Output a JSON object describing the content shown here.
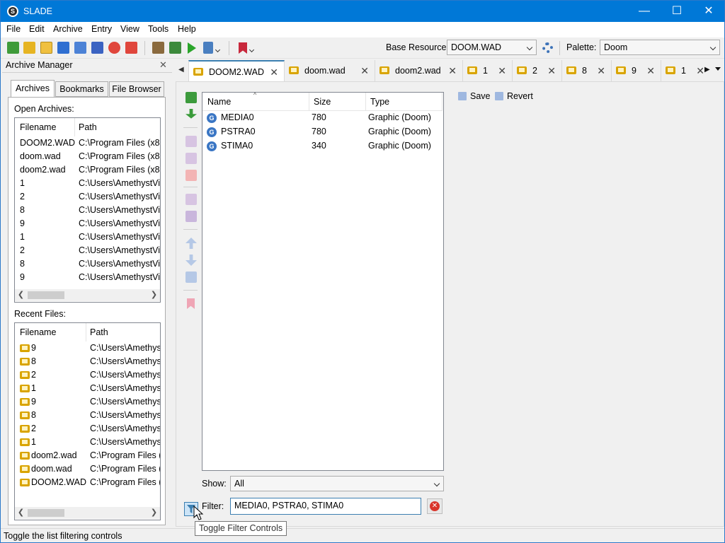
{
  "app": {
    "title": "SLADE",
    "icon_letter": "S"
  },
  "window_buttons": {
    "minimize": "—",
    "maximize": "☐",
    "close": "✕"
  },
  "menu": [
    "File",
    "Edit",
    "Archive",
    "Entry",
    "View",
    "Tools",
    "Help"
  ],
  "toolbar": {
    "base_resource_label": "Base Resource:",
    "base_resource_value": "DOOM.WAD",
    "palette_label": "Palette:",
    "palette_value": "Doom",
    "icons": [
      "new-archive-icon",
      "new-zip-icon",
      "open-icon",
      "open-dir-icon",
      "save-icon",
      "save-as-icon",
      "save-all-icon",
      "close-icon",
      "close-all-icon",
      "texture-editor-icon",
      "map-editor-icon",
      "run-icon",
      "tools-icon",
      "bookmark-icon"
    ]
  },
  "archive_manager": {
    "title": "Archive Manager",
    "close": "✕",
    "tabs": [
      "Archives",
      "Bookmarks",
      "File Browser"
    ],
    "open_archives_label": "Open Archives:",
    "open_headers": [
      "Filename",
      "Path"
    ],
    "open_rows": [
      [
        "DOOM2.WAD",
        "C:\\Program Files (x86"
      ],
      [
        "doom.wad",
        "C:\\Program Files (x86"
      ],
      [
        "doom2.wad",
        "C:\\Program Files (x86"
      ],
      [
        "1",
        "C:\\Users\\AmethystVip"
      ],
      [
        "2",
        "C:\\Users\\AmethystVip"
      ],
      [
        "8",
        "C:\\Users\\AmethystVip"
      ],
      [
        "9",
        "C:\\Users\\AmethystVip"
      ],
      [
        "1",
        "C:\\Users\\AmethystVip"
      ],
      [
        "2",
        "C:\\Users\\AmethystVip"
      ],
      [
        "8",
        "C:\\Users\\AmethystVip"
      ],
      [
        "9",
        "C:\\Users\\AmethystVip"
      ]
    ],
    "recent_label": "Recent Files:",
    "recent_headers": [
      "Filename",
      "Path"
    ],
    "recent_rows": [
      [
        "9",
        "C:\\Users\\Amethys"
      ],
      [
        "8",
        "C:\\Users\\Amethys"
      ],
      [
        "2",
        "C:\\Users\\Amethys"
      ],
      [
        "1",
        "C:\\Users\\Amethys"
      ],
      [
        "9",
        "C:\\Users\\Amethys"
      ],
      [
        "8",
        "C:\\Users\\Amethys"
      ],
      [
        "2",
        "C:\\Users\\Amethys"
      ],
      [
        "1",
        "C:\\Users\\Amethys"
      ],
      [
        "doom2.wad",
        "C:\\Program Files (:"
      ],
      [
        "doom.wad",
        "C:\\Program Files (:"
      ],
      [
        "DOOM2.WAD",
        "C:\\Program Files (:"
      ]
    ]
  },
  "doc_tabs": [
    "DOOM2.WAD",
    "doom.wad",
    "doom2.wad",
    "1",
    "2",
    "8",
    "9",
    "1"
  ],
  "entry_list": {
    "headers": [
      "Name",
      "Size",
      "Type"
    ],
    "rows": [
      [
        "MEDIA0",
        "780",
        "Graphic (Doom)"
      ],
      [
        "PSTRA0",
        "780",
        "Graphic (Doom)"
      ],
      [
        "STIMA0",
        "340",
        "Graphic (Doom)"
      ]
    ]
  },
  "actions": {
    "save": "Save",
    "revert": "Revert"
  },
  "show": {
    "label": "Show:",
    "value": "All"
  },
  "filter": {
    "label": "Filter:",
    "value": "MEDIA0, PSTRA0, STIMA0"
  },
  "tooltip": "Toggle Filter Controls",
  "status": "Toggle the list filtering controls",
  "colors": {
    "titlebar": "#0078d7",
    "accent": "#3c7fb1",
    "wad_icon": "#d9a400",
    "graphic_icon": "#3a76c4",
    "clear_filter": "#d9362c"
  }
}
